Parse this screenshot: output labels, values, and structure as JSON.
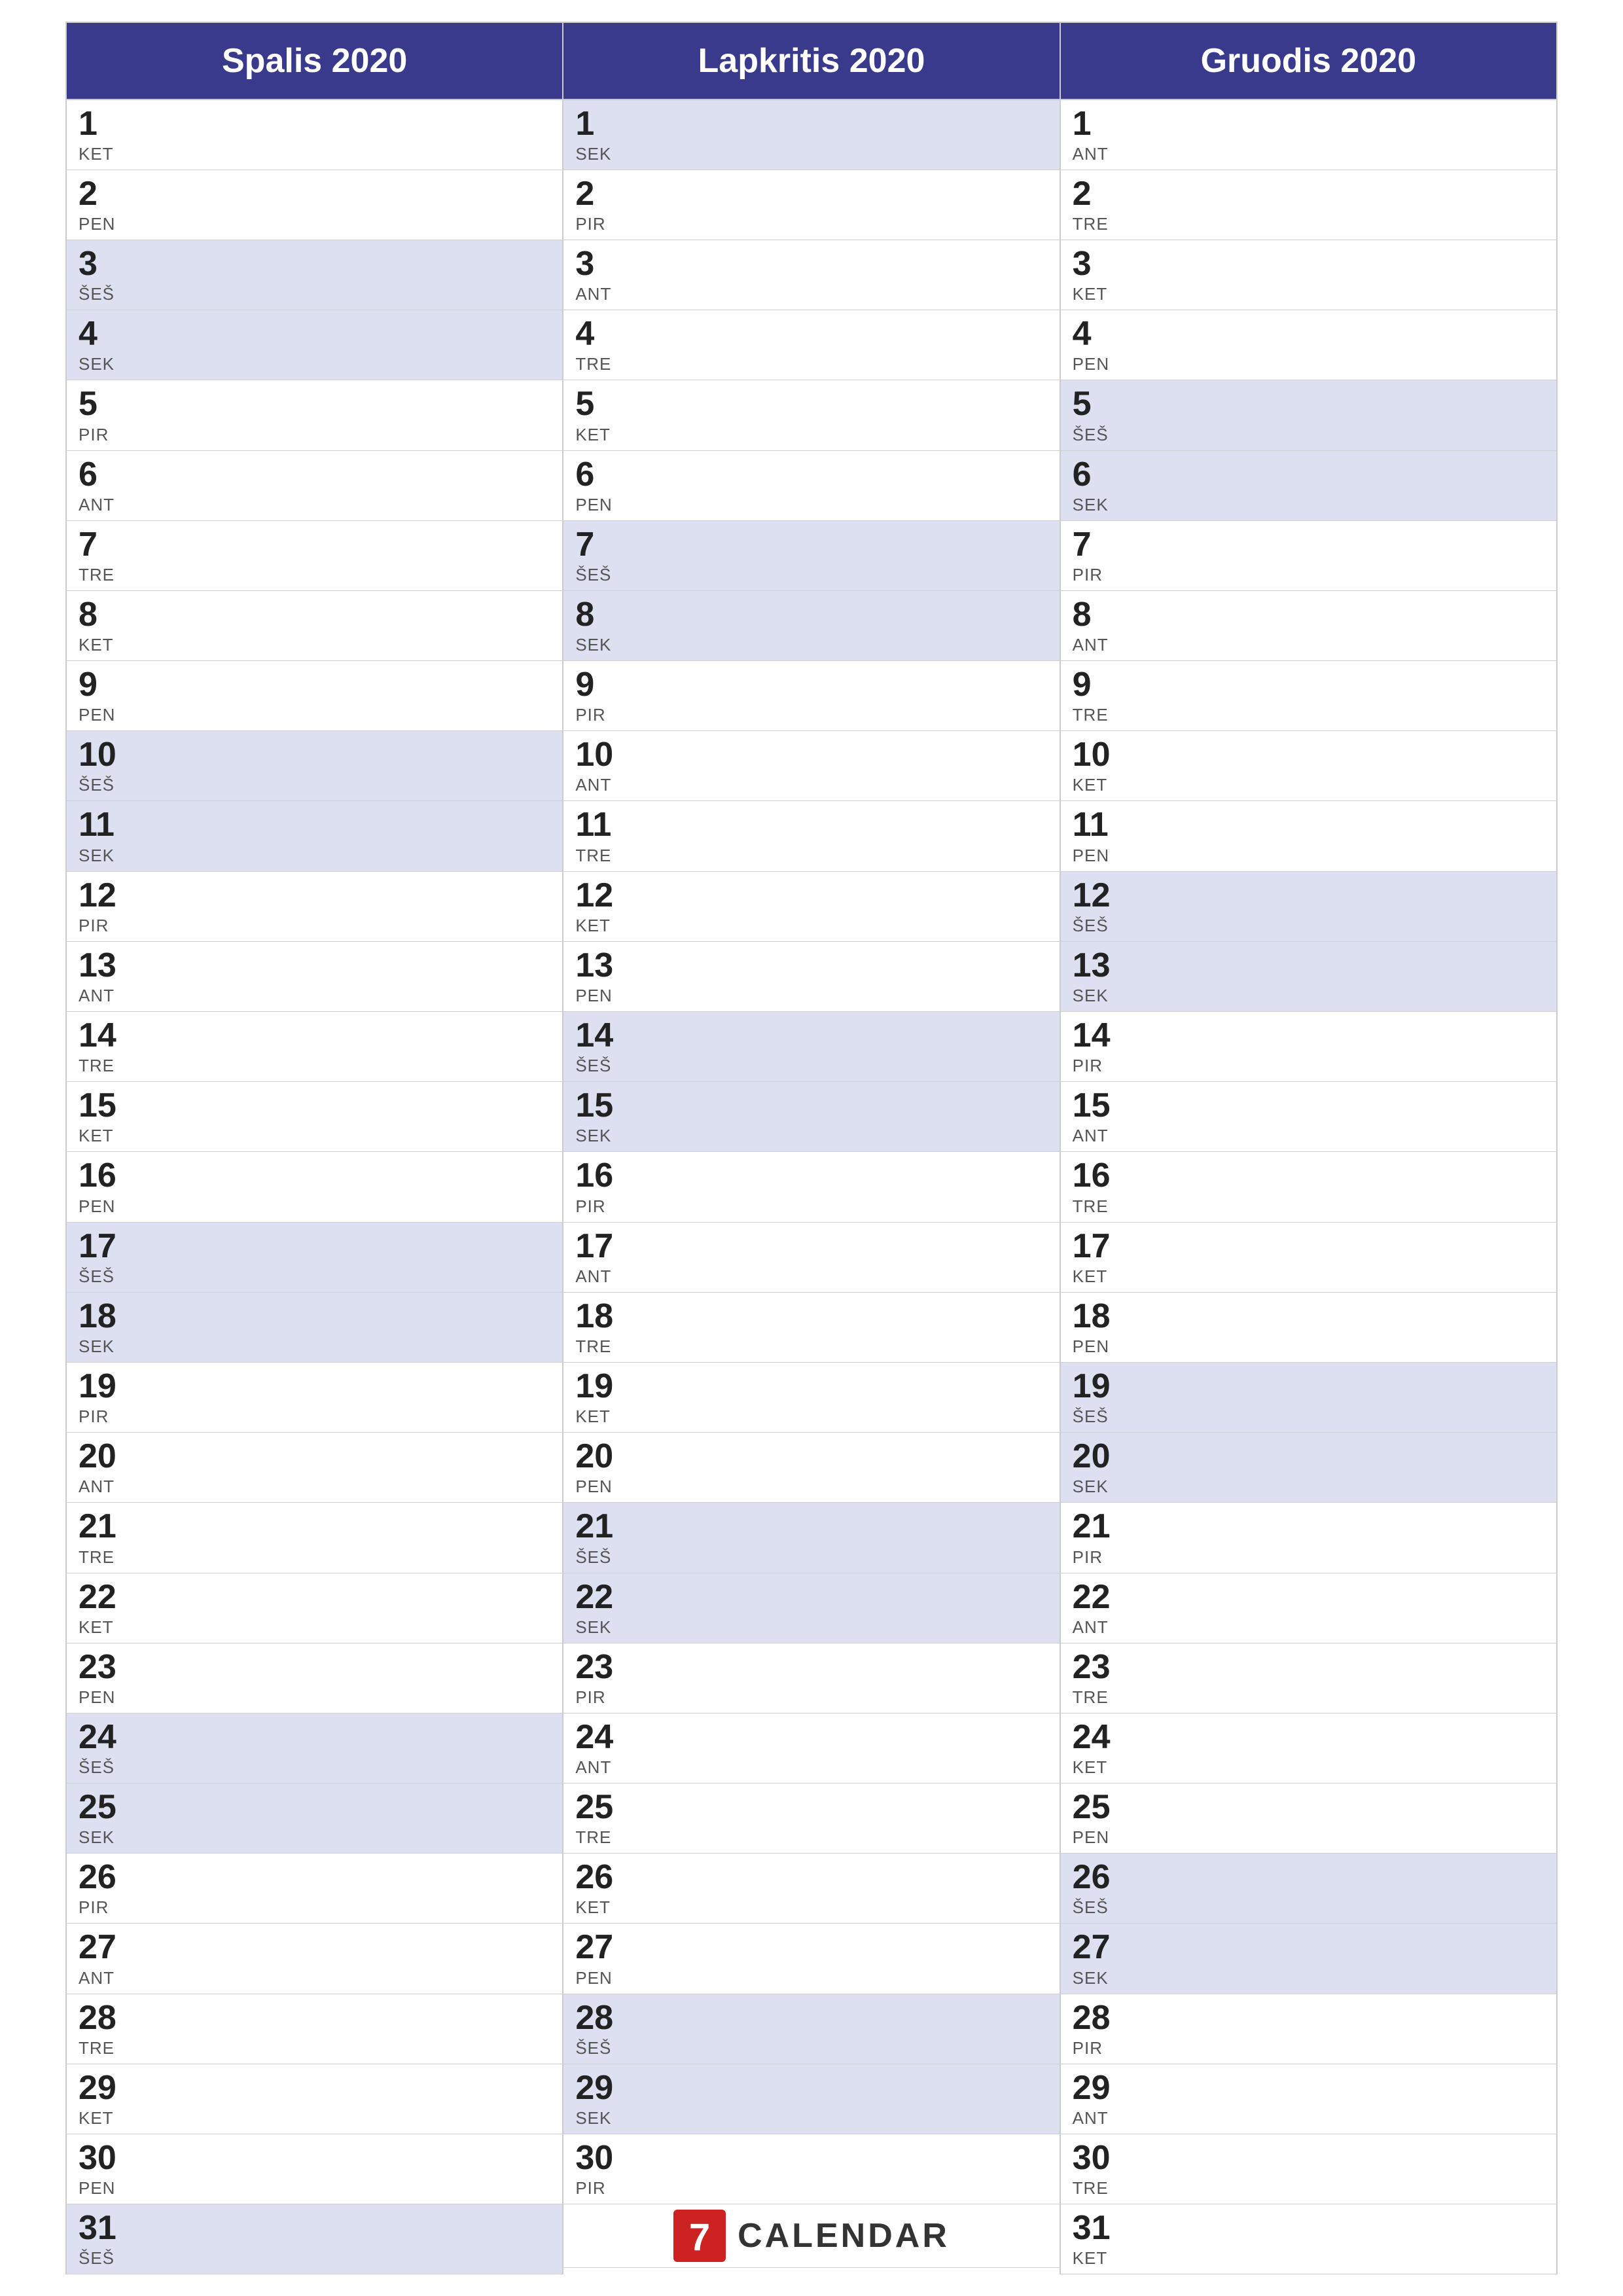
{
  "months": [
    {
      "name": "Spalis 2020",
      "id": "spalis",
      "days": [
        {
          "num": "1",
          "day": "KET",
          "weekend": false
        },
        {
          "num": "2",
          "day": "PEN",
          "weekend": false
        },
        {
          "num": "3",
          "day": "ŠEŠ",
          "weekend": true
        },
        {
          "num": "4",
          "day": "SEK",
          "weekend": true
        },
        {
          "num": "5",
          "day": "PIR",
          "weekend": false
        },
        {
          "num": "6",
          "day": "ANT",
          "weekend": false
        },
        {
          "num": "7",
          "day": "TRE",
          "weekend": false
        },
        {
          "num": "8",
          "day": "KET",
          "weekend": false
        },
        {
          "num": "9",
          "day": "PEN",
          "weekend": false
        },
        {
          "num": "10",
          "day": "ŠEŠ",
          "weekend": true
        },
        {
          "num": "11",
          "day": "SEK",
          "weekend": true
        },
        {
          "num": "12",
          "day": "PIR",
          "weekend": false
        },
        {
          "num": "13",
          "day": "ANT",
          "weekend": false
        },
        {
          "num": "14",
          "day": "TRE",
          "weekend": false
        },
        {
          "num": "15",
          "day": "KET",
          "weekend": false
        },
        {
          "num": "16",
          "day": "PEN",
          "weekend": false
        },
        {
          "num": "17",
          "day": "ŠEŠ",
          "weekend": true
        },
        {
          "num": "18",
          "day": "SEK",
          "weekend": true
        },
        {
          "num": "19",
          "day": "PIR",
          "weekend": false
        },
        {
          "num": "20",
          "day": "ANT",
          "weekend": false
        },
        {
          "num": "21",
          "day": "TRE",
          "weekend": false
        },
        {
          "num": "22",
          "day": "KET",
          "weekend": false
        },
        {
          "num": "23",
          "day": "PEN",
          "weekend": false
        },
        {
          "num": "24",
          "day": "ŠEŠ",
          "weekend": true
        },
        {
          "num": "25",
          "day": "SEK",
          "weekend": true
        },
        {
          "num": "26",
          "day": "PIR",
          "weekend": false
        },
        {
          "num": "27",
          "day": "ANT",
          "weekend": false
        },
        {
          "num": "28",
          "day": "TRE",
          "weekend": false
        },
        {
          "num": "29",
          "day": "KET",
          "weekend": false
        },
        {
          "num": "30",
          "day": "PEN",
          "weekend": false
        },
        {
          "num": "31",
          "day": "ŠEŠ",
          "weekend": true
        }
      ]
    },
    {
      "name": "Lapkritis 2020",
      "id": "lapkritis",
      "days": [
        {
          "num": "1",
          "day": "SEK",
          "weekend": true
        },
        {
          "num": "2",
          "day": "PIR",
          "weekend": false
        },
        {
          "num": "3",
          "day": "ANT",
          "weekend": false
        },
        {
          "num": "4",
          "day": "TRE",
          "weekend": false
        },
        {
          "num": "5",
          "day": "KET",
          "weekend": false
        },
        {
          "num": "6",
          "day": "PEN",
          "weekend": false
        },
        {
          "num": "7",
          "day": "ŠEŠ",
          "weekend": true
        },
        {
          "num": "8",
          "day": "SEK",
          "weekend": true
        },
        {
          "num": "9",
          "day": "PIR",
          "weekend": false
        },
        {
          "num": "10",
          "day": "ANT",
          "weekend": false
        },
        {
          "num": "11",
          "day": "TRE",
          "weekend": false
        },
        {
          "num": "12",
          "day": "KET",
          "weekend": false
        },
        {
          "num": "13",
          "day": "PEN",
          "weekend": false
        },
        {
          "num": "14",
          "day": "ŠEŠ",
          "weekend": true
        },
        {
          "num": "15",
          "day": "SEK",
          "weekend": true
        },
        {
          "num": "16",
          "day": "PIR",
          "weekend": false
        },
        {
          "num": "17",
          "day": "ANT",
          "weekend": false
        },
        {
          "num": "18",
          "day": "TRE",
          "weekend": false
        },
        {
          "num": "19",
          "day": "KET",
          "weekend": false
        },
        {
          "num": "20",
          "day": "PEN",
          "weekend": false
        },
        {
          "num": "21",
          "day": "ŠEŠ",
          "weekend": true
        },
        {
          "num": "22",
          "day": "SEK",
          "weekend": true
        },
        {
          "num": "23",
          "day": "PIR",
          "weekend": false
        },
        {
          "num": "24",
          "day": "ANT",
          "weekend": false
        },
        {
          "num": "25",
          "day": "TRE",
          "weekend": false
        },
        {
          "num": "26",
          "day": "KET",
          "weekend": false
        },
        {
          "num": "27",
          "day": "PEN",
          "weekend": false
        },
        {
          "num": "28",
          "day": "ŠEŠ",
          "weekend": true
        },
        {
          "num": "29",
          "day": "SEK",
          "weekend": true
        },
        {
          "num": "30",
          "day": "PIR",
          "weekend": false
        }
      ]
    },
    {
      "name": "Gruodis 2020",
      "id": "gruodis",
      "days": [
        {
          "num": "1",
          "day": "ANT",
          "weekend": false
        },
        {
          "num": "2",
          "day": "TRE",
          "weekend": false
        },
        {
          "num": "3",
          "day": "KET",
          "weekend": false
        },
        {
          "num": "4",
          "day": "PEN",
          "weekend": false
        },
        {
          "num": "5",
          "day": "ŠEŠ",
          "weekend": true
        },
        {
          "num": "6",
          "day": "SEK",
          "weekend": true
        },
        {
          "num": "7",
          "day": "PIR",
          "weekend": false
        },
        {
          "num": "8",
          "day": "ANT",
          "weekend": false
        },
        {
          "num": "9",
          "day": "TRE",
          "weekend": false
        },
        {
          "num": "10",
          "day": "KET",
          "weekend": false
        },
        {
          "num": "11",
          "day": "PEN",
          "weekend": false
        },
        {
          "num": "12",
          "day": "ŠEŠ",
          "weekend": true
        },
        {
          "num": "13",
          "day": "SEK",
          "weekend": true
        },
        {
          "num": "14",
          "day": "PIR",
          "weekend": false
        },
        {
          "num": "15",
          "day": "ANT",
          "weekend": false
        },
        {
          "num": "16",
          "day": "TRE",
          "weekend": false
        },
        {
          "num": "17",
          "day": "KET",
          "weekend": false
        },
        {
          "num": "18",
          "day": "PEN",
          "weekend": false
        },
        {
          "num": "19",
          "day": "ŠEŠ",
          "weekend": true
        },
        {
          "num": "20",
          "day": "SEK",
          "weekend": true
        },
        {
          "num": "21",
          "day": "PIR",
          "weekend": false
        },
        {
          "num": "22",
          "day": "ANT",
          "weekend": false
        },
        {
          "num": "23",
          "day": "TRE",
          "weekend": false
        },
        {
          "num": "24",
          "day": "KET",
          "weekend": false
        },
        {
          "num": "25",
          "day": "PEN",
          "weekend": false
        },
        {
          "num": "26",
          "day": "ŠEŠ",
          "weekend": true
        },
        {
          "num": "27",
          "day": "SEK",
          "weekend": true
        },
        {
          "num": "28",
          "day": "PIR",
          "weekend": false
        },
        {
          "num": "29",
          "day": "ANT",
          "weekend": false
        },
        {
          "num": "30",
          "day": "TRE",
          "weekend": false
        },
        {
          "num": "31",
          "day": "KET",
          "weekend": false
        }
      ]
    }
  ],
  "footer": {
    "logo_text": "CALENDAR",
    "logo_number": "7"
  }
}
